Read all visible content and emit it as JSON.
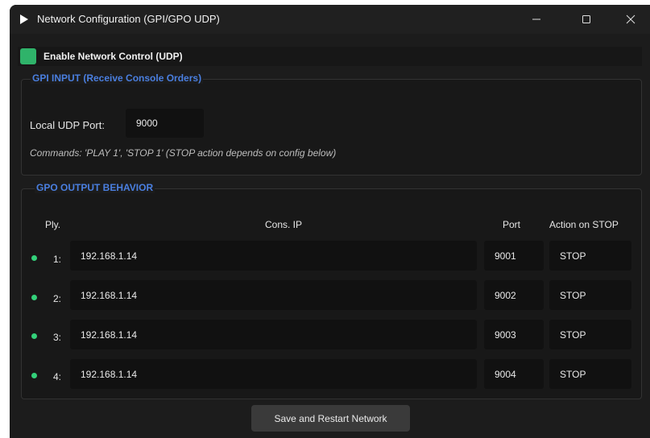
{
  "window": {
    "title": "Network Configuration (GPI/GPO UDP)"
  },
  "enable": {
    "label": "Enable Network Control (UDP)",
    "checked": true
  },
  "gpi": {
    "title": "GPI INPUT (Receive Console Orders)",
    "port_label": "Local UDP Port:",
    "port_value": "9000",
    "hint": "Commands: 'PLAY 1', 'STOP 1' (STOP action depends on config below)"
  },
  "gpo": {
    "title": "GPO OUTPUT  BEHAVIOR",
    "headers": {
      "ply": "Ply.",
      "ip": "Cons. IP",
      "port": "Port",
      "action": "Action on STOP"
    },
    "rows": [
      {
        "num": "1:",
        "ip": "192.168.1.14",
        "port": "9001",
        "action": "STOP"
      },
      {
        "num": "2:",
        "ip": "192.168.1.14",
        "port": "9002",
        "action": "STOP"
      },
      {
        "num": "3:",
        "ip": "192.168.1.14",
        "port": "9003",
        "action": "STOP"
      },
      {
        "num": "4:",
        "ip": "192.168.1.14",
        "port": "9004",
        "action": "STOP"
      }
    ]
  },
  "save_button": "Save and Restart Network",
  "colors": {
    "accent": "#4a7fe0",
    "status": "#33d17a",
    "checkbox": "#2fb36a"
  }
}
